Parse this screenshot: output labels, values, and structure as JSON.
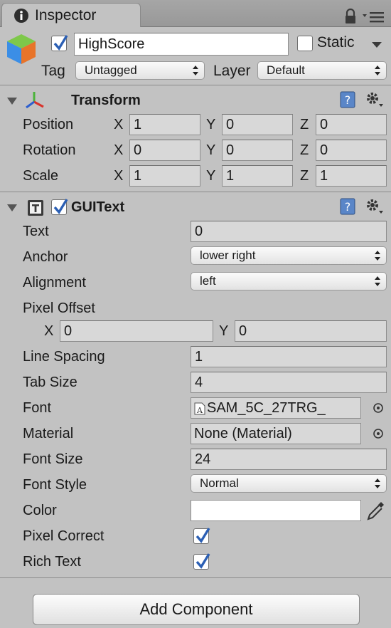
{
  "tab": {
    "label": "Inspector"
  },
  "header": {
    "active": true,
    "name": "HighScore",
    "static_label": "Static",
    "static_checked": false,
    "tag_label": "Tag",
    "tag_value": "Untagged",
    "layer_label": "Layer",
    "layer_value": "Default"
  },
  "transform": {
    "title": "Transform",
    "rows": [
      {
        "label": "Position",
        "x": "1",
        "y": "0",
        "z": "0"
      },
      {
        "label": "Rotation",
        "x": "0",
        "y": "0",
        "z": "0"
      },
      {
        "label": "Scale",
        "x": "1",
        "y": "1",
        "z": "1"
      }
    ],
    "axes": {
      "x": "X",
      "y": "Y",
      "z": "Z"
    }
  },
  "guitext": {
    "title": "GUIText",
    "enabled": true,
    "text_label": "Text",
    "text_value": "0",
    "anchor_label": "Anchor",
    "anchor_value": "lower right",
    "alignment_label": "Alignment",
    "alignment_value": "left",
    "pixel_offset_label": "Pixel Offset",
    "pixel_offset": {
      "x_label": "X",
      "x": "0",
      "y_label": "Y",
      "y": "0"
    },
    "line_spacing_label": "Line Spacing",
    "line_spacing_value": "1",
    "tab_size_label": "Tab Size",
    "tab_size_value": "4",
    "font_label": "Font",
    "font_value": "SAM_5C_27TRG_",
    "material_label": "Material",
    "material_value": "None (Material)",
    "font_size_label": "Font Size",
    "font_size_value": "24",
    "font_style_label": "Font Style",
    "font_style_value": "Normal",
    "color_label": "Color",
    "color_value": "#ffffff",
    "pixel_correct_label": "Pixel Correct",
    "pixel_correct": true,
    "rich_text_label": "Rich Text",
    "rich_text": true
  },
  "add_component_label": "Add Component"
}
